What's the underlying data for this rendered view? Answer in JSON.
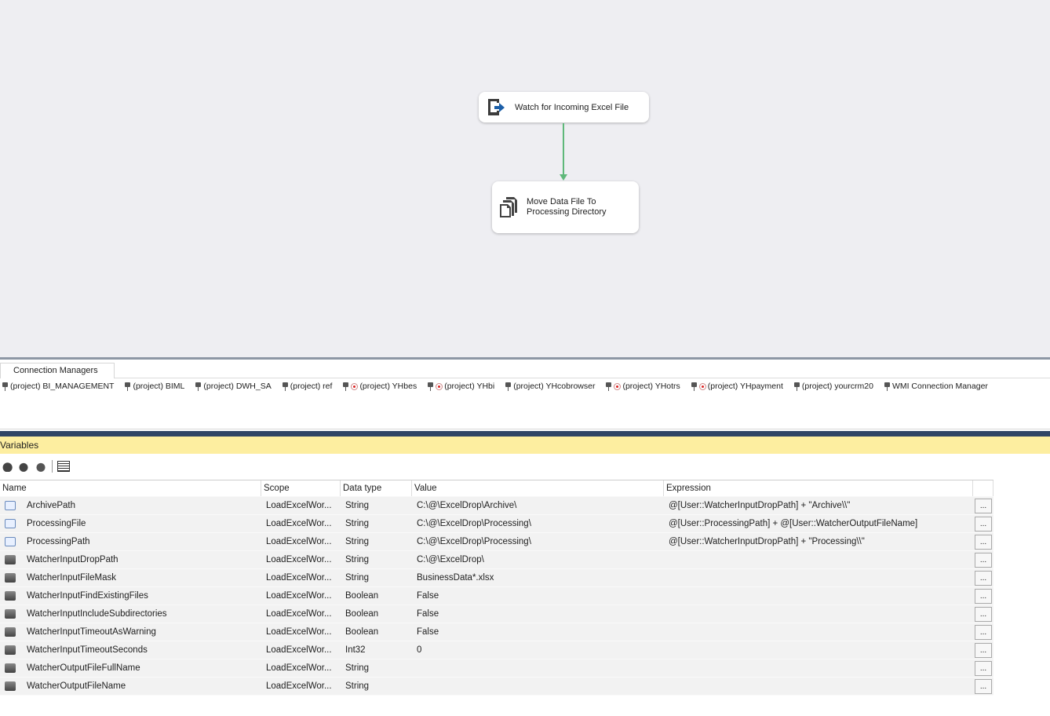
{
  "canvas": {
    "tasks": [
      {
        "label": "Watch for Incoming Excel File",
        "icon": "file-watcher-icon"
      },
      {
        "label": "Move Data File To Processing Directory",
        "icon": "file-system-task-icon"
      }
    ],
    "precedence_color": "#5fb87a"
  },
  "connection_managers": {
    "tab": "Connection Managers",
    "items": [
      {
        "label": "(project) BI_MANAGEMENT",
        "offline": false
      },
      {
        "label": "(project) BIML",
        "offline": false
      },
      {
        "label": "(project) DWH_SA",
        "offline": false
      },
      {
        "label": "(project) ref",
        "offline": false
      },
      {
        "label": "(project) YHbes",
        "offline": true
      },
      {
        "label": "(project) YHbi",
        "offline": true
      },
      {
        "label": "(project) YHcobrowser",
        "offline": false
      },
      {
        "label": "(project) YHotrs",
        "offline": true
      },
      {
        "label": "(project) YHpayment",
        "offline": true
      },
      {
        "label": "(project) yourcrm20",
        "offline": false
      },
      {
        "label": "WMI Connection Manager",
        "offline": false
      }
    ]
  },
  "variables": {
    "title": "Variables",
    "columns": [
      "Name",
      "Scope",
      "Data type",
      "Value",
      "Expression"
    ],
    "button_label": "...",
    "rows": [
      {
        "name": "ArchivePath",
        "scope": "LoadExcelWor...",
        "type": "String",
        "value": "C:\\@\\ExcelDrop\\Archive\\",
        "expression": "@[User::WatcherInputDropPath] + \"Archive\\\\\""
      },
      {
        "name": "ProcessingFile",
        "scope": "LoadExcelWor...",
        "type": "String",
        "value": "C:\\@\\ExcelDrop\\Processing\\",
        "expression": "@[User::ProcessingPath] + @[User::WatcherOutputFileName]"
      },
      {
        "name": "ProcessingPath",
        "scope": "LoadExcelWor...",
        "type": "String",
        "value": "C:\\@\\ExcelDrop\\Processing\\",
        "expression": "@[User::WatcherInputDropPath] + \"Processing\\\\\""
      },
      {
        "name": "WatcherInputDropPath",
        "scope": "LoadExcelWor...",
        "type": "String",
        "value": "C:\\@\\ExcelDrop\\",
        "expression": ""
      },
      {
        "name": "WatcherInputFileMask",
        "scope": "LoadExcelWor...",
        "type": "String",
        "value": "BusinessData*.xlsx",
        "expression": ""
      },
      {
        "name": "WatcherInputFindExistingFiles",
        "scope": "LoadExcelWor...",
        "type": "Boolean",
        "value": "False",
        "expression": ""
      },
      {
        "name": "WatcherInputIncludeSubdirectories",
        "scope": "LoadExcelWor...",
        "type": "Boolean",
        "value": "False",
        "expression": ""
      },
      {
        "name": "WatcherInputTimeoutAsWarning",
        "scope": "LoadExcelWor...",
        "type": "Boolean",
        "value": "False",
        "expression": ""
      },
      {
        "name": "WatcherInputTimeoutSeconds",
        "scope": "LoadExcelWor...",
        "type": "Int32",
        "value": "0",
        "expression": ""
      },
      {
        "name": "WatcherOutputFileFullName",
        "scope": "LoadExcelWor...",
        "type": "String",
        "value": "",
        "expression": ""
      },
      {
        "name": "WatcherOutputFileName",
        "scope": "LoadExcelWor...",
        "type": "String",
        "value": "",
        "expression": ""
      }
    ]
  }
}
